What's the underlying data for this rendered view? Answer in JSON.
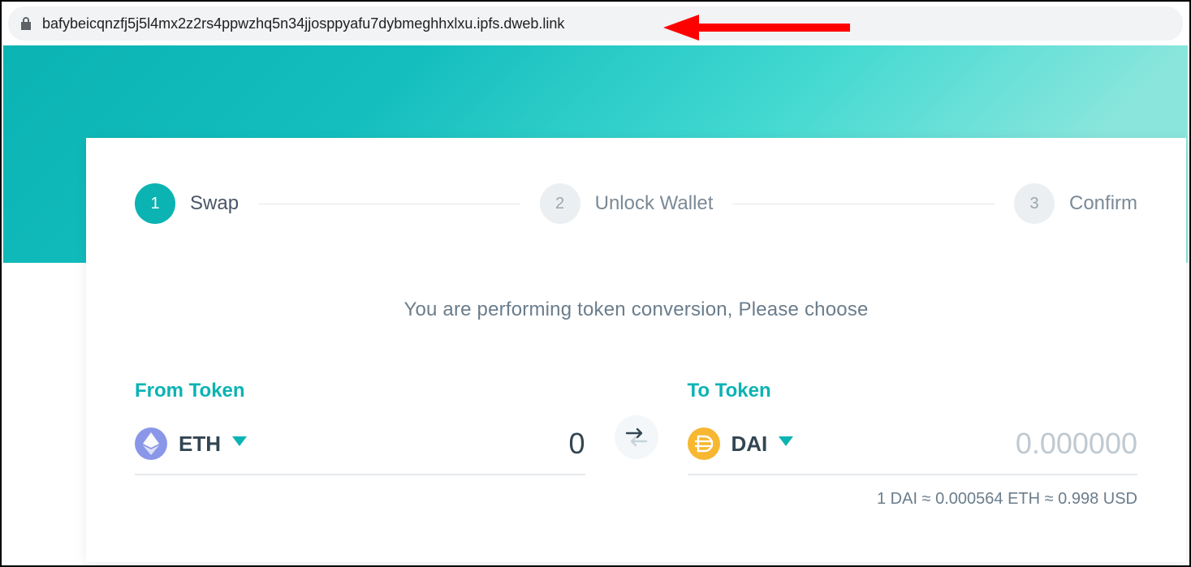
{
  "address_bar": {
    "url": "bafybeicqnzfj5j5l4mx2z2rs4ppwzhq5n34jjosppyafu7dybmeghhxlxu.ipfs.dweb.link"
  },
  "steps": [
    {
      "num": "1",
      "label": "Swap",
      "active": true
    },
    {
      "num": "2",
      "label": "Unlock Wallet",
      "active": false
    },
    {
      "num": "3",
      "label": "Confirm",
      "active": false
    }
  ],
  "intro": "You are performing token conversion, Please choose",
  "from": {
    "title": "From Token",
    "symbol": "ETH",
    "amount": "0"
  },
  "to": {
    "title": "To Token",
    "symbol": "DAI",
    "amount": "0.000000"
  },
  "rate": "1 DAI ≈ 0.000564 ETH ≈ 0.998 USD",
  "colors": {
    "accent": "#0bb3b3",
    "eth": "#8a97e8",
    "dai": "#f7b731",
    "arrow": "#ff0000"
  }
}
